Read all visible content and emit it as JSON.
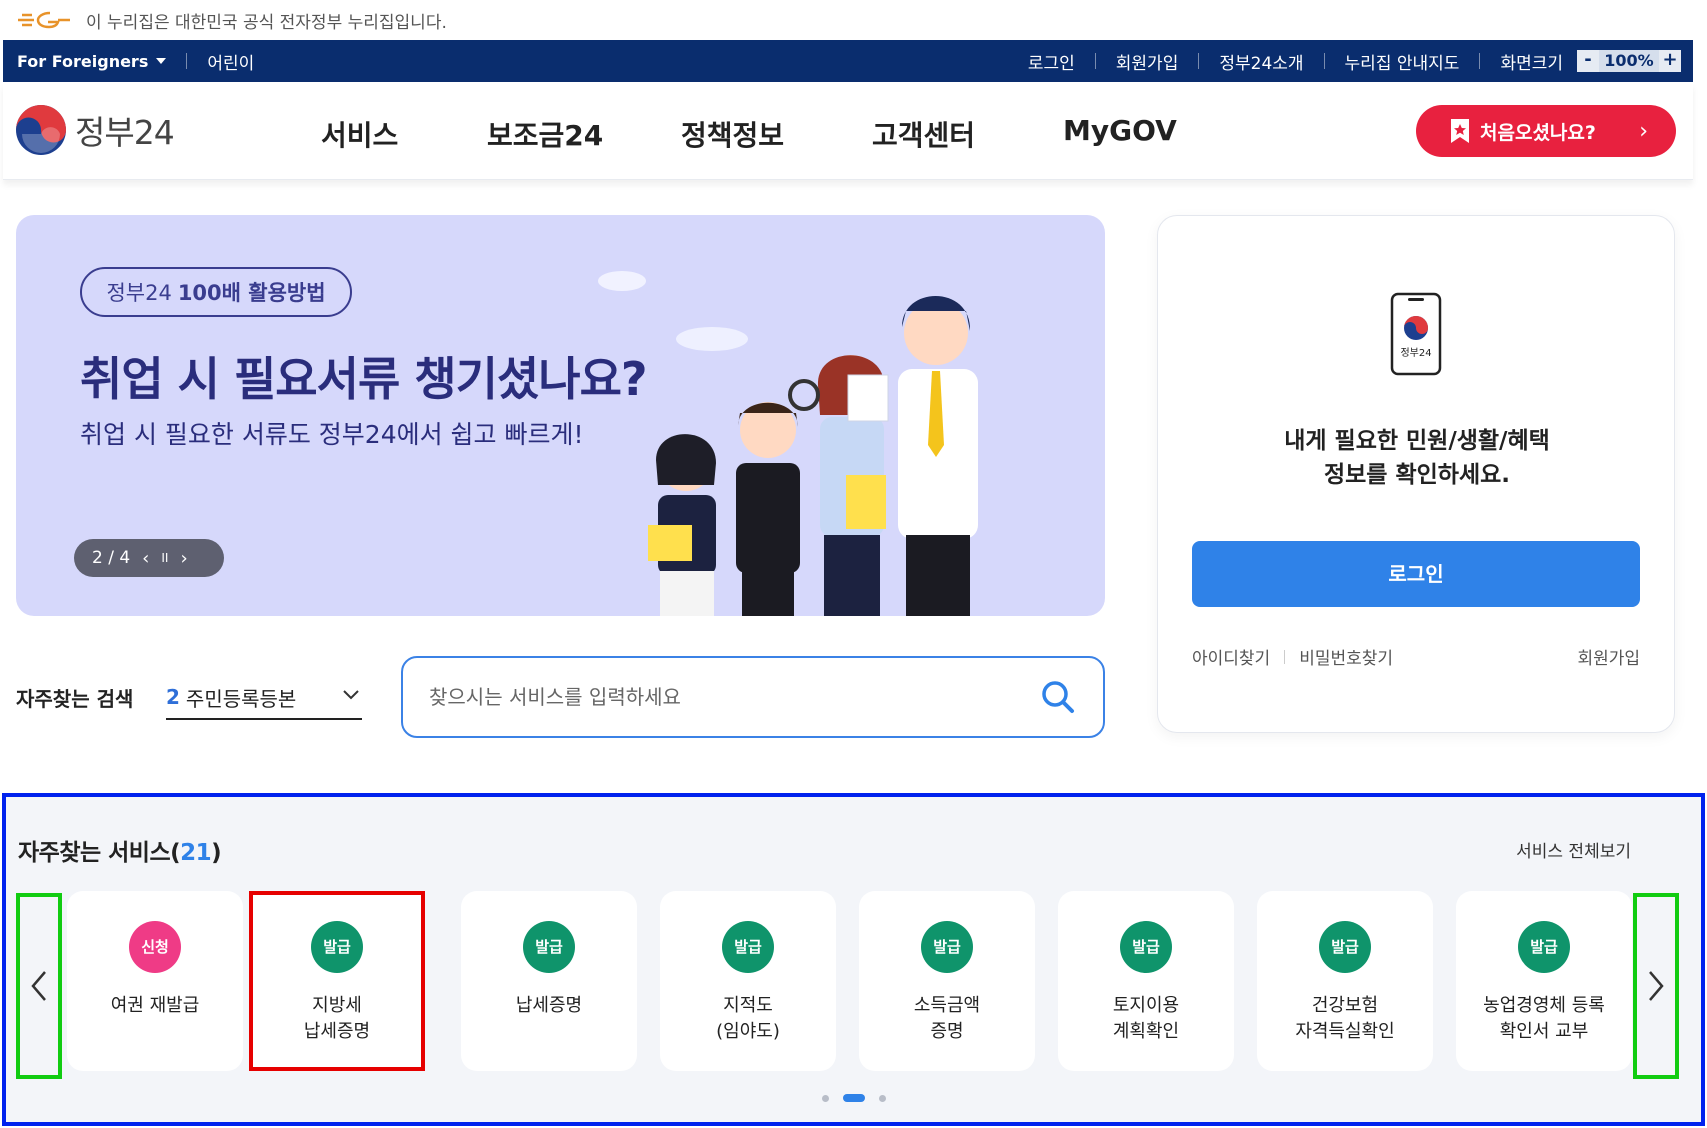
{
  "notice": {
    "text": "이 누리집은 대한민국 공식 전자정부 누리집입니다."
  },
  "util": {
    "foreigners": "For Foreigners",
    "kids": "어린이",
    "links": [
      "로그인",
      "회원가입",
      "정부24소개",
      "누리집 안내지도",
      "화면크기"
    ],
    "zoom_minus": "-",
    "zoom_value": "100%",
    "zoom_plus": "+"
  },
  "header": {
    "logo_text": "정부24",
    "nav": [
      "서비스",
      "보조금24",
      "정책정보",
      "고객센터",
      "MyGOV"
    ],
    "first_visit": "처음오셨나요?"
  },
  "banner": {
    "tag_prefix": "정부24",
    "tag_bold": "100배 활용방법",
    "title": "취업 시 필요서류 챙기셨나요?",
    "subtitle": "취업 시 필요한 서류도 정부24에서 쉽고 빠르게!",
    "pager": "2 / 4",
    "prev": "‹",
    "pause": "II",
    "next": "›"
  },
  "login": {
    "phone_label": "정부24",
    "message_line1": "내게 필요한 민원/생활/혜택",
    "message_line2": "정보를 확인하세요.",
    "button": "로그인",
    "find_id": "아이디찾기",
    "find_pw": "비밀번호찾기",
    "signup": "회원가입"
  },
  "search": {
    "label": "자주찾는 검색",
    "rank": "2",
    "selected": "주민등록등본",
    "placeholder": "찾으시는 서비스를 입력하세요"
  },
  "services": {
    "title": "자주찾는 서비스",
    "count_open": "(",
    "count": "21",
    "count_close": ")",
    "view_all": "서비스 전체보기",
    "items": [
      {
        "badge": "신청",
        "badge_type": "apply",
        "name": "여권 재발급"
      },
      {
        "badge": "발급",
        "badge_type": "issue",
        "name": "지방세\n납세증명"
      },
      {
        "badge": "발급",
        "badge_type": "issue",
        "name": "납세증명"
      },
      {
        "badge": "발급",
        "badge_type": "issue",
        "name": "지적도\n(임야도)"
      },
      {
        "badge": "발급",
        "badge_type": "issue",
        "name": "소득금액\n증명"
      },
      {
        "badge": "발급",
        "badge_type": "issue",
        "name": "토지이용\n계획확인"
      },
      {
        "badge": "발급",
        "badge_type": "issue",
        "name": "건강보험\n자격득실확인"
      },
      {
        "badge": "발급",
        "badge_type": "issue",
        "name": "농업경영체 등록\n확인서 교부"
      }
    ],
    "pagination": {
      "pages": 3,
      "active": 2
    }
  },
  "colors": {
    "util_bar": "#0a2d6e",
    "accent_red": "#e8213f",
    "primary_blue": "#2f82e8",
    "issue_badge": "#0f946b",
    "apply_badge": "#ef3b86",
    "banner_bg": "#d6d8fb"
  },
  "icons": [
    "eg-logo-icon",
    "caret-down-icon",
    "gov24-logo-icon",
    "bookmark-icon",
    "chevron-right-icon",
    "phone-icon",
    "search-icon",
    "chevron-down-icon",
    "chevron-left-icon"
  ]
}
